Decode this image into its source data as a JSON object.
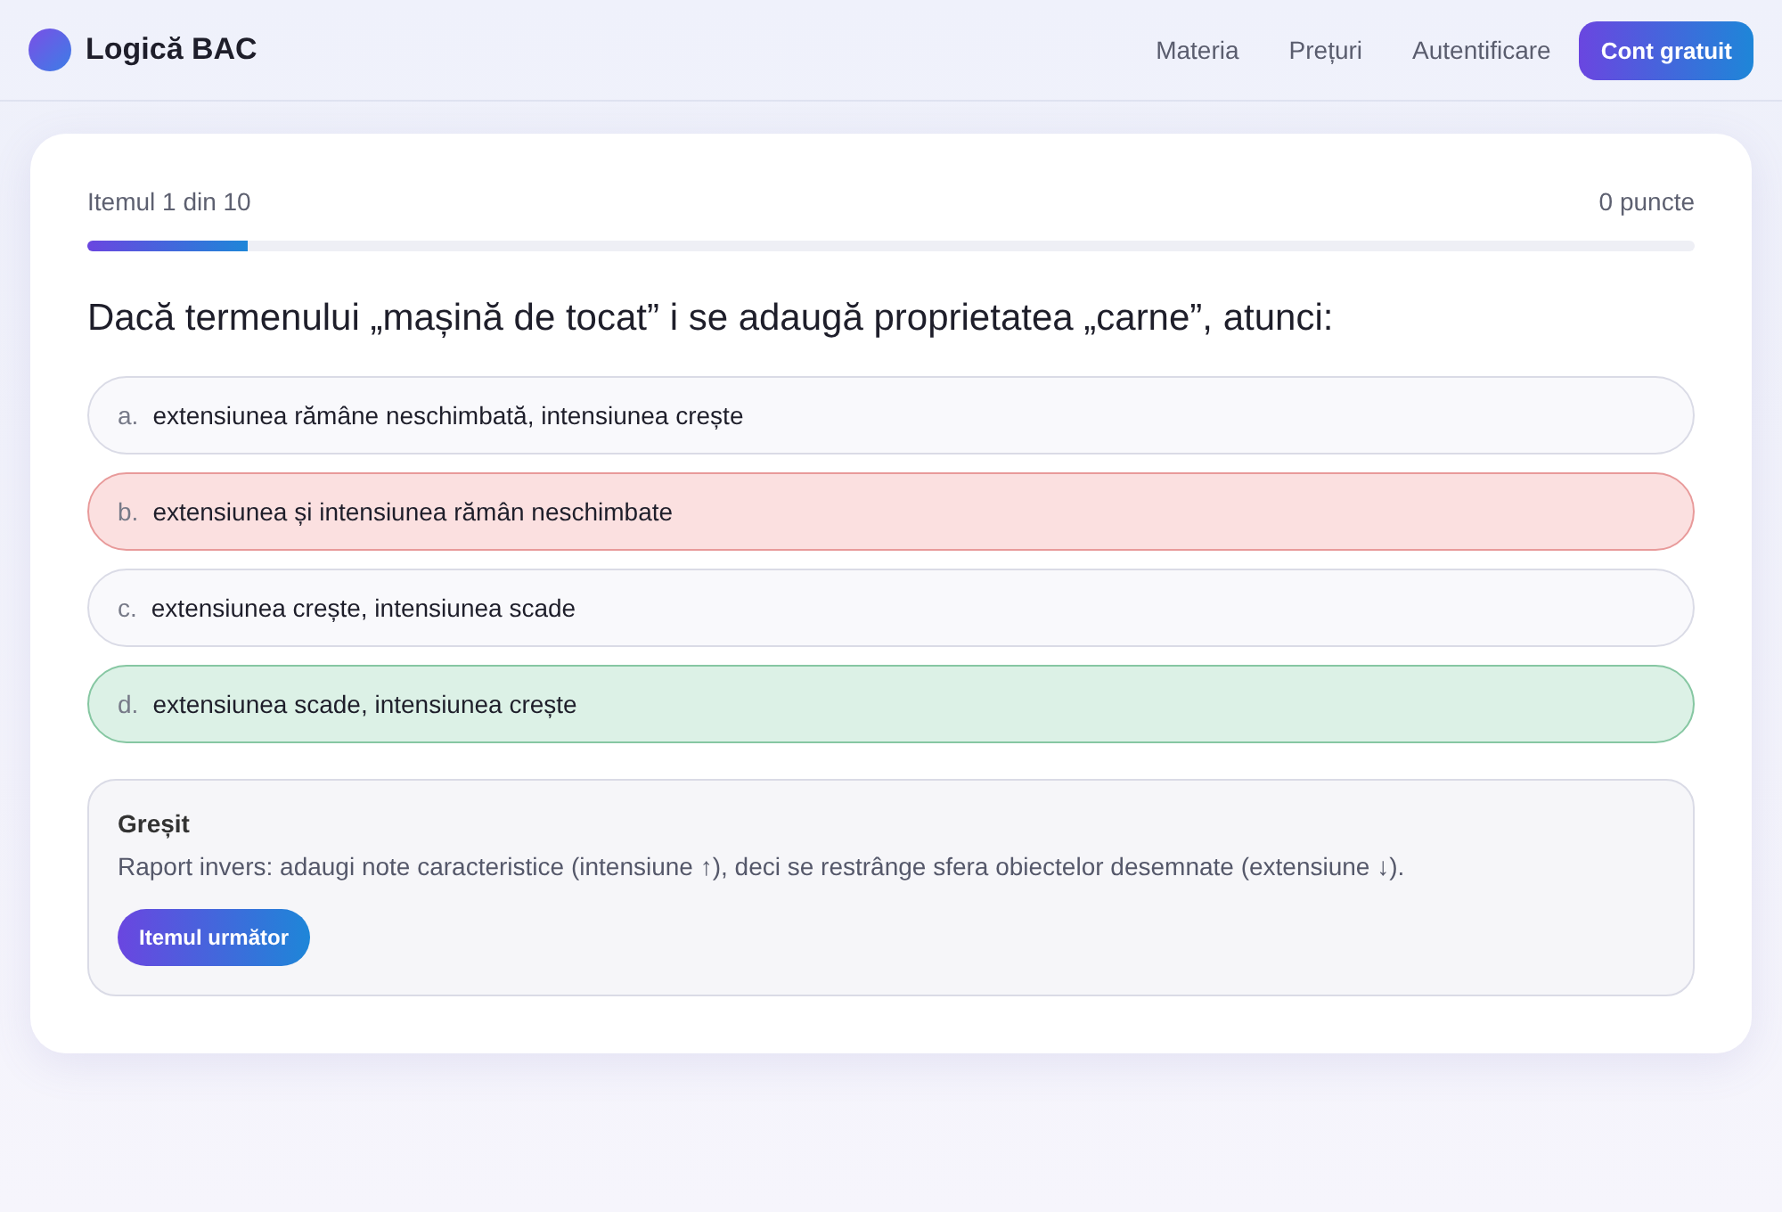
{
  "header": {
    "brand": "Logică BAC",
    "nav": [
      {
        "label": "Materia"
      },
      {
        "label": "Prețuri"
      },
      {
        "label": "Autentificare"
      }
    ],
    "cta": "Cont gratuit"
  },
  "quiz": {
    "progress_label": "Itemul 1 din 10",
    "score": "0 puncte",
    "level": 0.1,
    "question": "Dacă termenului „mașină de tocat” i se adaugă proprietatea „carne”, atunci:",
    "options": [
      {
        "letter": "a.",
        "text": "extensiunea rămâne neschimbată, intensiunea crește",
        "selected": false,
        "correct": false
      },
      {
        "letter": "b.",
        "text": "extensiunea și intensiunea rămân neschimbate",
        "selected": true,
        "correct": false
      },
      {
        "letter": "c.",
        "text": "extensiunea crește, intensiunea scade",
        "selected": false,
        "correct": false
      },
      {
        "letter": "d.",
        "text": "extensiunea scade, intensiunea crește",
        "selected": false,
        "correct": true
      }
    ],
    "feedback": {
      "verdict": "Greșit",
      "explanation": "Raport invers: adaugi note caracteristice (intensiune ↑), deci se restrânge sfera obiectelor desemnate (extensiune ↓).",
      "button": "Itemul următor"
    }
  }
}
